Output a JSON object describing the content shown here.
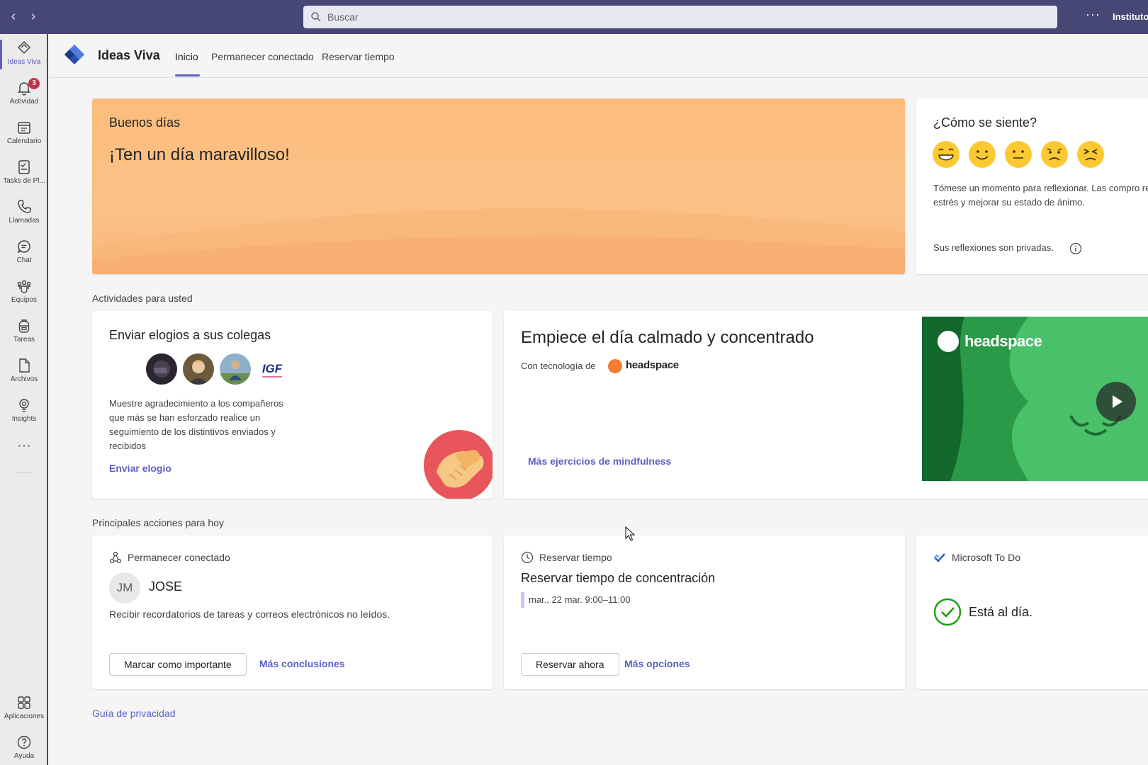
{
  "topbar": {
    "back_icon": "chevron-left-icon",
    "forward_icon": "chevron-right-icon",
    "search_placeholder": "Buscar",
    "more_label": "···",
    "org_name": "Instituto G"
  },
  "rail": {
    "items": [
      {
        "label": "Ideas Viva",
        "icon": "viva-insights-icon",
        "active": true
      },
      {
        "label": "Actividad",
        "icon": "bell-icon",
        "badge": "3"
      },
      {
        "label": "Calendario",
        "icon": "calendar-icon"
      },
      {
        "label": "Tasks de Pl...",
        "icon": "tasks-icon"
      },
      {
        "label": "Llamadas",
        "icon": "phone-icon"
      },
      {
        "label": "Chat",
        "icon": "chat-icon"
      },
      {
        "label": "Equipos",
        "icon": "teams-icon"
      },
      {
        "label": "Tareas",
        "icon": "backpack-icon"
      },
      {
        "label": "Archivos",
        "icon": "file-icon"
      },
      {
        "label": "Insights",
        "icon": "lightbulb-icon"
      }
    ],
    "more_label": "···",
    "bottom": [
      {
        "label": "Aplicaciones",
        "icon": "apps-icon"
      },
      {
        "label": "Ayuda",
        "icon": "help-icon"
      }
    ]
  },
  "app": {
    "title": "Ideas Viva",
    "tabs": [
      {
        "label": "Inicio",
        "active": true
      },
      {
        "label": "Permanecer conectado"
      },
      {
        "label": "Reservar tiempo"
      }
    ]
  },
  "greeting": {
    "title": "Buenos días",
    "message": "¡Ten un día maravilloso!"
  },
  "feeling": {
    "title": "¿Cómo se siente?",
    "text": "Tómese un momento para reflexionar. Las compro reducir su estrés y mejorar su estado de ánimo.",
    "private_note": "Sus reflexiones son privadas."
  },
  "activities": {
    "section_label": "Actividades para usted",
    "praise": {
      "title": "Enviar elogios a sus colegas",
      "text": "Muestre agradecimiento a los compañeros que más se han esforzado realice un seguimiento de los distintivos enviados y recibidos",
      "link": "Enviar elogio",
      "avatar_logo_text": "IGF"
    },
    "calm": {
      "title": "Empiece el día calmado y concentrado",
      "powered_by": "Con tecnología de",
      "brand": "headspace",
      "link": "Más ejercicios de mindfulness",
      "video_brand": "headspace"
    }
  },
  "actions": {
    "section_label": "Principales acciones para hoy",
    "connect": {
      "header": "Permanecer conectado",
      "initials": "JM",
      "person": "JOSE",
      "text": "Recibir recordatorios de tareas y correos electrónicos no leídos.",
      "button": "Marcar como importante",
      "link": "Más conclusiones"
    },
    "book": {
      "header": "Reservar tiempo",
      "title": "Reservar tiempo de concentración",
      "slot": "mar., 22 mar. 9:00–11:00",
      "button": "Reservar ahora",
      "link": "Más opciones"
    },
    "todo": {
      "header": "Microsoft To Do",
      "status": "Está al día."
    }
  },
  "footer": {
    "privacy_link": "Guía de privacidad"
  },
  "colors": {
    "brand": "#464775",
    "accent": "#5b5fc7",
    "greeting_bg": "#fcbd7c",
    "headspace_orange": "#f47d31",
    "headspace_green": "#1e8a3e",
    "success": "#13a10e",
    "badge": "#c4314b"
  }
}
